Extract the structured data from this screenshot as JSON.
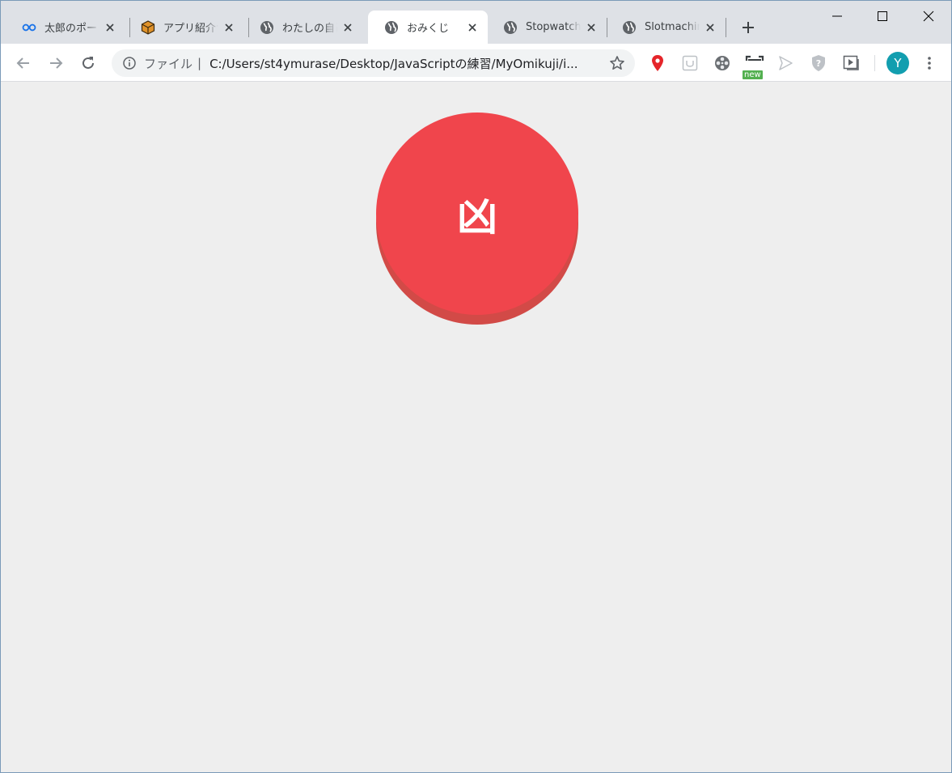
{
  "tabs": [
    {
      "title": "太郎のポートフォリオ",
      "icon": "infinity-icon",
      "active": false
    },
    {
      "title": "アプリ紹介サイト",
      "icon": "box-icon",
      "active": false
    },
    {
      "title": "わたしの自己紹介",
      "icon": "globe-icon",
      "active": false
    },
    {
      "title": "おみくじ",
      "icon": "globe-icon",
      "active": true
    },
    {
      "title": "Stopwatch",
      "icon": "globe-icon",
      "active": false
    },
    {
      "title": "Slotmachine",
      "icon": "globe-icon",
      "active": false
    }
  ],
  "omnibox": {
    "scheme_label": "ファイル",
    "separator": "|",
    "url": "C:/Users/st4ymurase/Desktop/JavaScriptの練習/MyOmikuji/i..."
  },
  "extensions": {
    "new_badge": "new"
  },
  "profile": {
    "initial": "Y"
  },
  "omikuji": {
    "result": "凶"
  },
  "colors": {
    "accent": "#f0454c",
    "accent_shadow": "#d24a47",
    "background": "#eeeeee",
    "tabstrip": "#dee1e6",
    "avatar": "#129eaf"
  }
}
